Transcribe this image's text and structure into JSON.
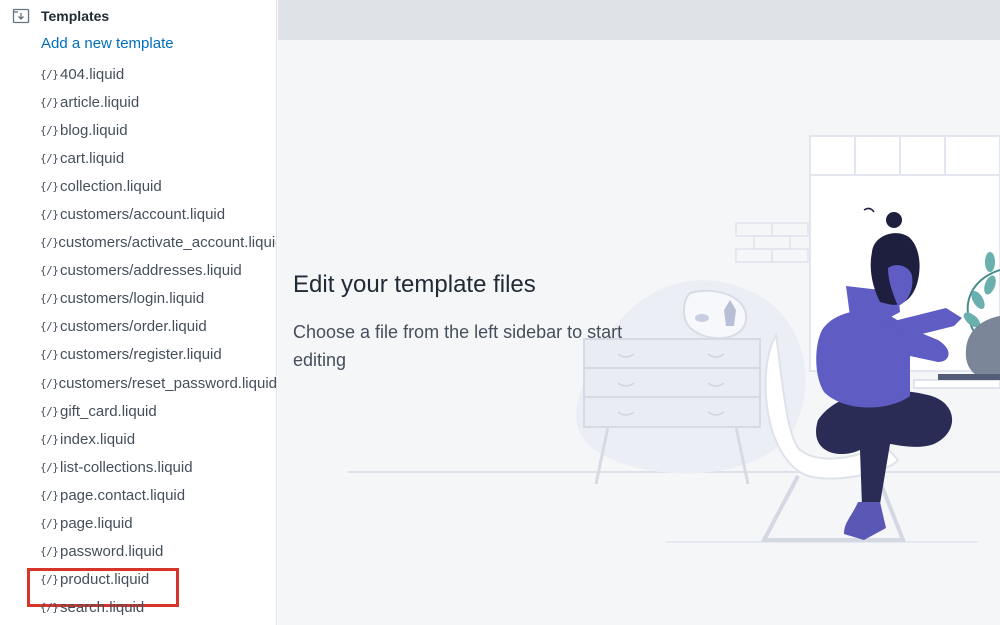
{
  "sidebar": {
    "section_title": "Templates",
    "add_link": "Add a new template",
    "files": [
      "404.liquid",
      "article.liquid",
      "blog.liquid",
      "cart.liquid",
      "collection.liquid",
      "customers/account.liquid",
      "customers/activate_account.liquid",
      "customers/addresses.liquid",
      "customers/login.liquid",
      "customers/order.liquid",
      "customers/register.liquid",
      "customers/reset_password.liquid",
      "gift_card.liquid",
      "index.liquid",
      "list-collections.liquid",
      "page.contact.liquid",
      "page.liquid",
      "password.liquid",
      "product.liquid",
      "search.liquid"
    ],
    "file_icon_glyph": "{/}",
    "highlighted_file": "product.liquid"
  },
  "main": {
    "title": "Edit your template files",
    "subtitle": "Choose a file from the left sidebar to start editing"
  },
  "icons": {
    "section": "folder-download-icon",
    "file": "liquid-file-icon"
  },
  "colors": {
    "link": "#006fbb",
    "highlight_border": "#d7342a",
    "text": "#454f5b",
    "main_bg": "#f4f6f8",
    "topbar_bg": "#dfe3e8"
  }
}
